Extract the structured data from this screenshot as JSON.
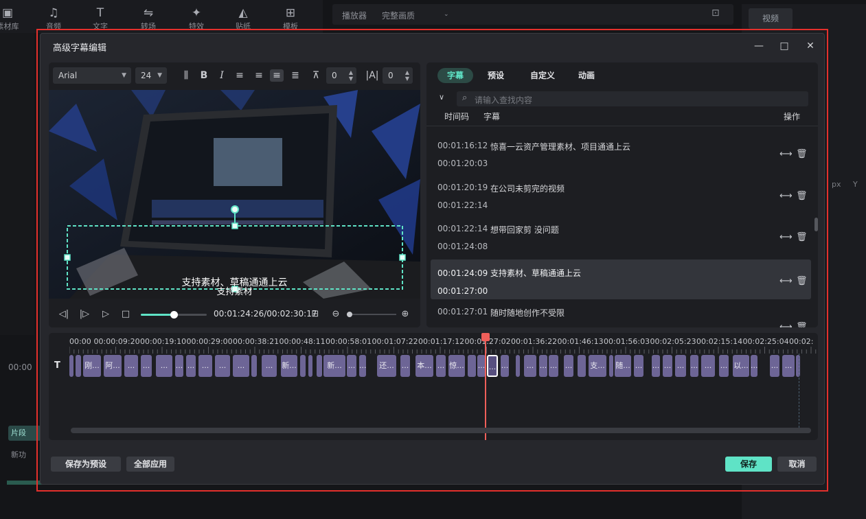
{
  "background": {
    "tools": [
      {
        "label": "素材库",
        "icon": "media-icon"
      },
      {
        "label": "音频",
        "icon": "music-note-icon"
      },
      {
        "label": "文字",
        "icon": "text-icon"
      },
      {
        "label": "转场",
        "icon": "transition-icon"
      },
      {
        "label": "特效",
        "icon": "effects-icon"
      },
      {
        "label": "贴纸",
        "icon": "sticker-icon"
      },
      {
        "label": "模板",
        "icon": "template-icon"
      }
    ],
    "player_label": "播放器",
    "quality_label": "完整画质",
    "right_tab": "视频",
    "px_label": "px",
    "y_label": "Y",
    "bg_time": "00:00",
    "bg_track1": "片段",
    "bg_track2": "新功"
  },
  "dialog": {
    "title": "高级字幕编辑",
    "font": "Arial",
    "size": "24",
    "spacing": "0",
    "line_spacing": "0",
    "preview_text_main": "支持素材、草稿通通上云",
    "preview_text_sub": "支持素材",
    "time_current": "00:01:24:26",
    "time_total": "00:02:30:17",
    "progress_fraction": 0.5
  },
  "subtitles_panel": {
    "tabs": [
      {
        "label": "字幕",
        "active": true
      },
      {
        "label": "预设",
        "active": false
      },
      {
        "label": "自定义",
        "active": false
      },
      {
        "label": "动画",
        "active": false
      }
    ],
    "search_placeholder": "请输入查找内容",
    "col_timecode": "时间码",
    "col_subtitle": "字幕",
    "col_action": "操作",
    "rows": [
      {
        "start": "00:01:16:12",
        "end": "00:01:20:03",
        "text": "惊喜一云资产管理素材、项目通通上云",
        "selected": false
      },
      {
        "start": "00:01:20:19",
        "end": "00:01:22:14",
        "text": "在公司未剪完的视频",
        "selected": false
      },
      {
        "start": "00:01:22:14",
        "end": "00:01:24:08",
        "text": "想带回家剪 没问题",
        "selected": false
      },
      {
        "start": "00:01:24:09",
        "end": "00:01:27:00",
        "text": "支持素材、草稿通通上云",
        "selected": true
      },
      {
        "start": "00:01:27:01",
        "end": "",
        "text": "随时随地创作不受限",
        "selected": false
      }
    ]
  },
  "timeline": {
    "ruler": [
      "00:00",
      "00:00:09:20",
      "00:00:19:10",
      "00:00:29:00",
      "00:00:38:21",
      "00:00:48:11",
      "00:00:58:01",
      "00:01:07:22",
      "00:01:17:12",
      "00:01:27:02",
      "00:01:36:22",
      "00:01:46:13",
      "00:01:56:03",
      "00:02:05:23",
      "00:02:15:14",
      "00:02:25:04",
      "00:02:"
    ],
    "track_icon": "T",
    "clip_labels": [
      "刚...",
      "阿...",
      "...",
      "开...",
      "新...",
      "新...",
      "还...",
      "本...",
      "惊...",
      "支...",
      "随...",
      "以..."
    ],
    "filler": "..."
  },
  "footer": {
    "save_preset": "保存为预设",
    "apply_all": "全部应用",
    "save": "保存",
    "cancel": "取消"
  },
  "colors": {
    "accent": "#5fe3c6",
    "clip": "#6d6596",
    "playhead": "#ef5f5a",
    "frame": "#e5302c"
  }
}
